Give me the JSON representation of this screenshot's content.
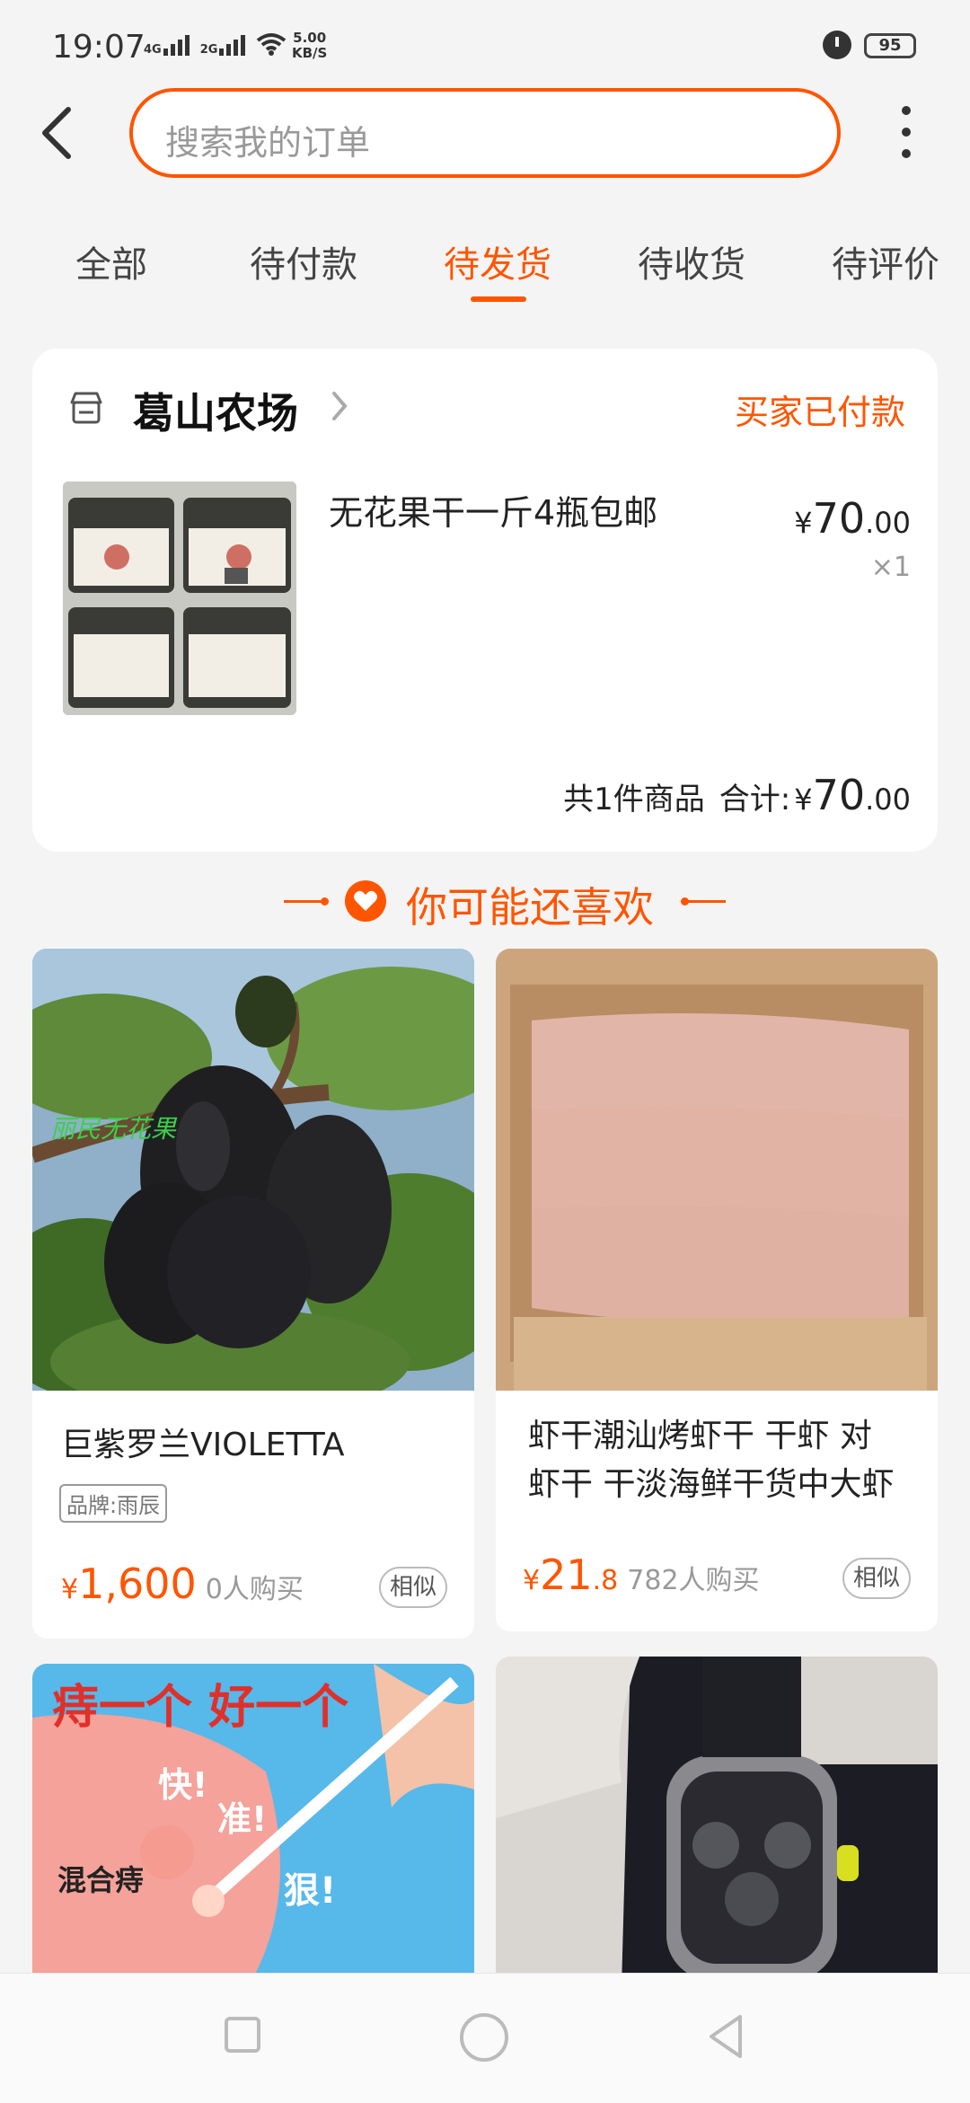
{
  "status_bar": {
    "time": "19:07",
    "network1": "4G",
    "network2": "2G",
    "speed_value": "5.00",
    "speed_unit": "KB/S",
    "battery": "95",
    "icons": [
      "signal-4g-icon",
      "signal-2g-icon",
      "wifi-icon",
      "alarm-icon",
      "battery-icon"
    ]
  },
  "header": {
    "back_icon": "chevron-left-icon",
    "search_placeholder": "搜索我的订单",
    "more_icon": "more-vertical-icon"
  },
  "tabs": [
    {
      "label": "全部",
      "active": false
    },
    {
      "label": "待付款",
      "active": false
    },
    {
      "label": "待发货",
      "active": true
    },
    {
      "label": "待收货",
      "active": false
    },
    {
      "label": "待评价",
      "active": false
    }
  ],
  "order": {
    "shop_name": "葛山农场",
    "status": "买家已付款",
    "product_title": "无花果干一斤4瓶包邮",
    "price_currency": "¥",
    "price_int": "70",
    "price_dec": ".00",
    "quantity": "×1",
    "total_count": "共1件商品",
    "total_label": "合计:",
    "total_currency": "¥",
    "total_int": "70",
    "total_dec": ".00"
  },
  "recommend": {
    "title": "你可能还喜欢",
    "items": [
      {
        "title": "巨紫罗兰VIOLETTA",
        "brand": "品牌:雨辰",
        "image_watermark": "丽民无花果",
        "price_currency": "¥",
        "price_int": "1,600",
        "price_dec": "",
        "sales": "0人购买",
        "similar": "相似"
      },
      {
        "title_line1": "虾干潮汕烤虾干 干虾 对",
        "title_line2": "虾干 干淡海鲜干货中大虾",
        "price_currency": "¥",
        "price_int": "21",
        "price_dec": ".8",
        "sales": "782人购买",
        "similar": "相似"
      },
      {
        "banner_text": "痔一个 好一个",
        "tag1": "快!",
        "tag2": "准!",
        "tag3": "狠!",
        "tag4": "混合痔"
      },
      {
        "image": "watch"
      }
    ]
  },
  "colors": {
    "accent": "#ff5500",
    "background": "#f4f4f4"
  }
}
